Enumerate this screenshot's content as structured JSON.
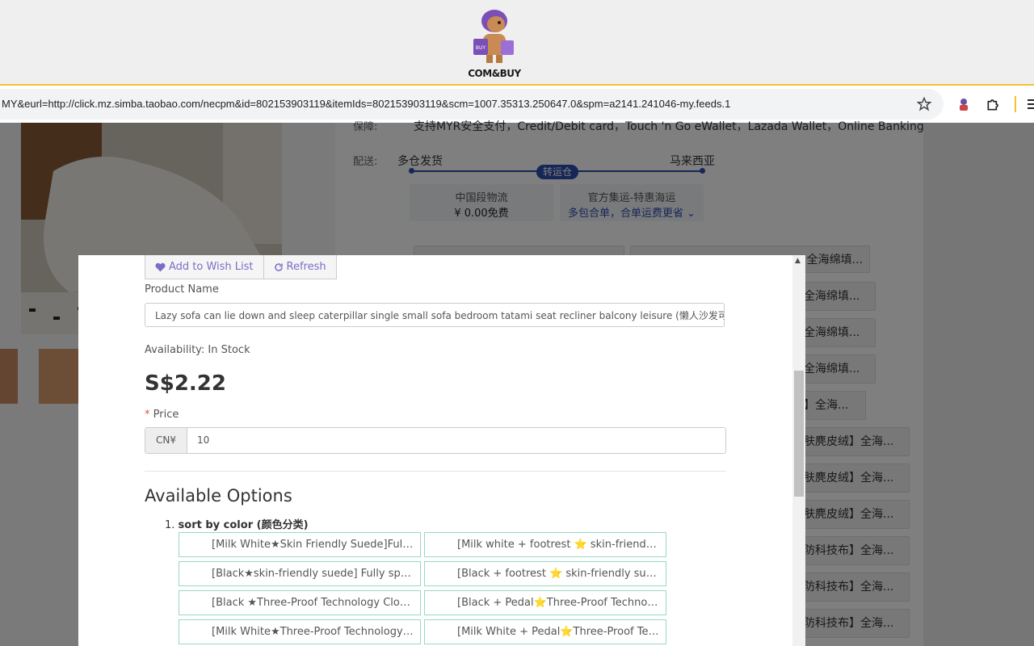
{
  "banner": {
    "logo_text": "COM&BUY"
  },
  "browser": {
    "url": "MY&eurl=http://click.mz.simba.taobao.com/necpm&id=802153903119&itemIds=802153903119&scm=1007.35313.250647.0&spm=a2141.241046-my.feeds.1"
  },
  "background": {
    "guarantee_label": "保障:",
    "guarantee_text": "支持MYR安全支付，Credit/Debit card，Touch 'n Go eWallet，Lazada Wallet，Online Banking",
    "shipping_label": "配送:",
    "ship_from": "多仓发货",
    "ship_to": "马来西亚",
    "transit_badge": "转运仓",
    "box1_title": "中国段物流",
    "box1_value": "¥ 0.00免费",
    "box2_title": "官方集运-特惠海运",
    "box2_value": "多包合单，合单运费更省",
    "pills": [
      "全海绵填...",
      "全海绵填...",
      "全海绵填...",
      "全海绵填...",
      "】全海...",
      "肤麂皮绒】全海...",
      "肤麂皮绒】全海...",
      "肤麂皮绒】全海...",
      "防科技布】全海...",
      "防科技布】全海...",
      "防科技布】全海..."
    ]
  },
  "modal": {
    "wishlist_label": "Add to Wish List",
    "refresh_label": "Refresh",
    "product_name_label": "Product Name",
    "product_name_value": "Lazy sofa can lie down and sleep caterpillar single small sofa bedroom tatami seat recliner balcony leisure (懒人沙发可",
    "availability": "Availability: In Stock",
    "price_display": "S$2.22",
    "price_required": "*",
    "price_label": "Price",
    "currency": "CN¥",
    "price_value": "10",
    "options_title": "Available Options",
    "group_number": "1.",
    "group_name": "sort by color (颜色分类)",
    "options": [
      "[Milk White★Skin Friendly Suede]Fully sponge filled",
      "[Milk white + footrest ⭐ skin-friendly suede]",
      "[Black★skin-friendly suede] Fully sponge filled",
      "[Black + footrest ⭐ skin-friendly suede]",
      "[Black ★Three-Proof Technology Cloth]",
      "[Black + Pedal⭐Three-Proof Technology Cloth]",
      "[Milk White★Three-Proof Technology Cloth]",
      "[Milk White + Pedal⭐Three-Proof Technology Cloth]"
    ]
  },
  "colors": {
    "accent": "#7e6bc8",
    "option_border": "#98d8c6",
    "route_blue": "#2b4cae",
    "banner_line": "#f2c230"
  }
}
